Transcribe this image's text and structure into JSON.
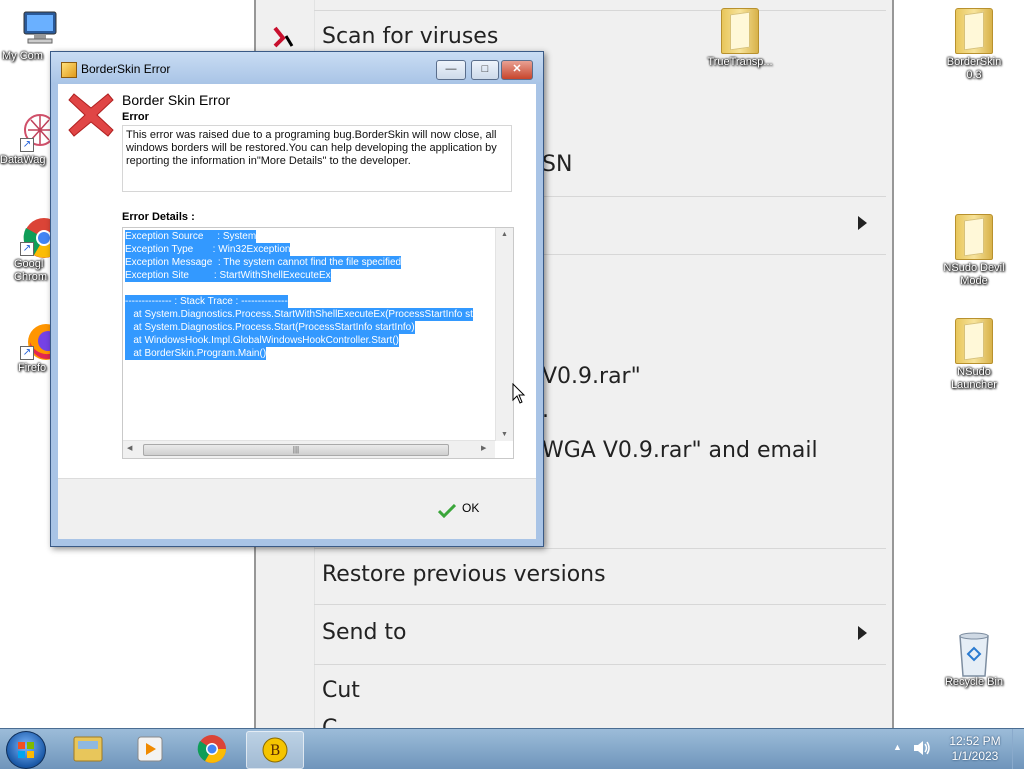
{
  "desktop": {
    "icons_left": [
      {
        "label": "My Com",
        "icon": "computer-icon"
      },
      {
        "label": "DataWag",
        "icon": "datawag-icon"
      },
      {
        "label": "Googl\nChrom",
        "icon": "chrome-icon"
      },
      {
        "label": "Firefo",
        "icon": "firefox-icon"
      }
    ],
    "icons_right": [
      {
        "label": "TrueTransp...",
        "icon": "folder-icon"
      },
      {
        "label": "BorderSkin\n0.3",
        "icon": "folder-icon"
      },
      {
        "label": "NSudo Devil\nMode",
        "icon": "folder-icon"
      },
      {
        "label": "NSudo\nLauncher",
        "icon": "nsudo-launcher-icon"
      },
      {
        "label": "Recycle Bin",
        "icon": "recycle-bin-icon"
      }
    ]
  },
  "context_menu": {
    "items": [
      {
        "label": "Scan for viruses"
      },
      {
        "label": "SN"
      },
      {
        "label": "V0.9.rar\""
      },
      {
        "label": "."
      },
      {
        "label": "WGA V0.9.rar\" and email"
      },
      {
        "label": "Restore previous versions"
      },
      {
        "label": "Send to"
      },
      {
        "label": "Cut"
      },
      {
        "label": "C"
      }
    ]
  },
  "dialog": {
    "title": "BorderSkin Error",
    "header": "Border Skin Error",
    "error_label": "Error",
    "message": "This error was raised due to a programing bug.BorderSkin will now close, all windows borders will be restored.You can help developing the application by reporting the information in\"More Details\" to the developer.",
    "details_label": "Error Details :",
    "details_lines": [
      "Exception Source     : System",
      "Exception Type       : Win32Exception",
      "Exception Message  : The system cannot find the file specified",
      "Exception Site         : StartWithShellExecuteEx",
      "",
      "-------------- : Stack Trace : --------------",
      "   at System.Diagnostics.Process.StartWithShellExecuteEx(ProcessStartInfo st",
      "   at System.Diagnostics.Process.Start(ProcessStartInfo startInfo)",
      "   at WindowsHook.Impl.GlobalWindowsHookController.Start()",
      "   at BorderSkin.Program.Main()"
    ],
    "ok_label": "OK",
    "minimize_glyph": "—",
    "maximize_glyph": "□",
    "close_glyph": "✕"
  },
  "taskbar": {
    "time": "12:52 PM",
    "date": "1/1/2023",
    "volume_icon": "speaker-icon",
    "notify_arrow": "▲"
  }
}
